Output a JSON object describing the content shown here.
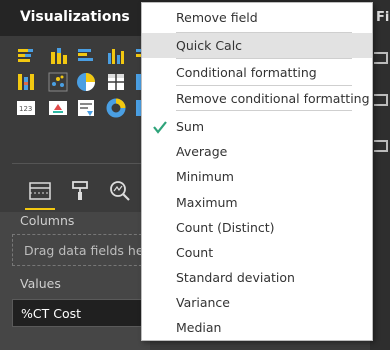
{
  "pane": {
    "title": "Visualizations",
    "right_strip_label": "Fi",
    "columns_label": "Columns",
    "columns_placeholder": "Drag data fields here",
    "values_label": "Values",
    "values_field": "%CT Cost",
    "tabs": [
      "fields-tab",
      "format-tab",
      "analytics-tab"
    ]
  },
  "context_menu": {
    "items": [
      {
        "label": "Remove field"
      },
      {
        "label": "Quick Calc",
        "highlighted": true
      },
      {
        "label": "Conditional formatting"
      },
      {
        "label": "Remove conditional formatting"
      },
      {
        "label": "Sum",
        "checked": true
      },
      {
        "label": "Average"
      },
      {
        "label": "Minimum"
      },
      {
        "label": "Maximum"
      },
      {
        "label": "Count (Distinct)"
      },
      {
        "label": "Count"
      },
      {
        "label": "Standard deviation"
      },
      {
        "label": "Variance"
      },
      {
        "label": "Median"
      }
    ]
  },
  "colors": {
    "accent": "#f2c811",
    "check": "#2ea37a",
    "icon_yellow": "#f2c811",
    "icon_blue": "#4a9fe3",
    "icon_teal": "#2eb8a4"
  }
}
